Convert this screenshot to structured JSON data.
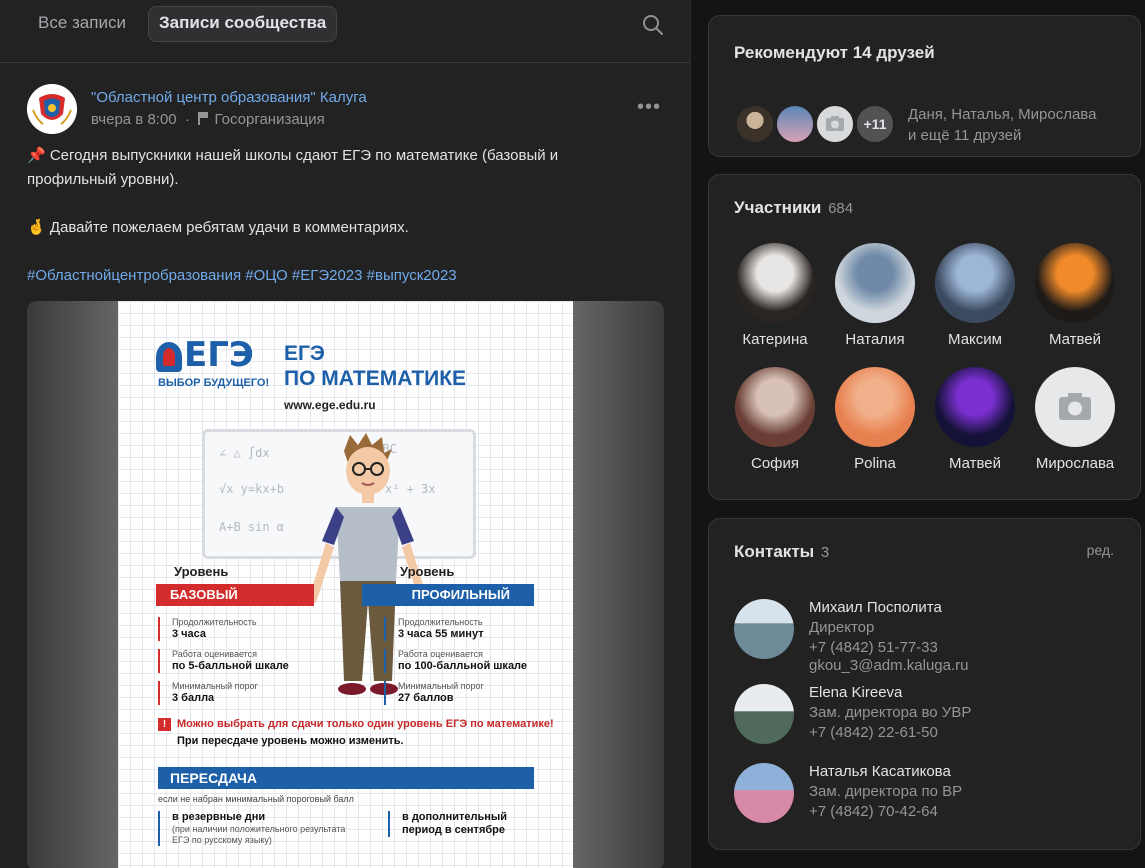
{
  "tabs": {
    "all": "Все записи",
    "community": "Записи сообщества"
  },
  "post": {
    "group_name": "\"Областной центр образования\" Калуга",
    "time": "вчера в 8:00",
    "category": "Госорганизация",
    "line1": "📌 Сегодня выпускники нашей школы сдают ЕГЭ по математике (базовый и профильный уровни).",
    "line2": "🤞 Давайте пожелаем ребятам удачи в комментариях.",
    "hashtags": "#Областнойцентробразования #ОЦО #ЕГЭ2023 #выпуск2023"
  },
  "poster": {
    "logo": "ЕГЭ",
    "logo_sub": "ВЫБОР БУДУЩЕГО!",
    "title1": "ЕГЭ",
    "title2": "ПО МАТЕМАТИКЕ",
    "url": "www.ege.edu.ru",
    "level_word": "Уровень",
    "basic": "БАЗОВЫЙ",
    "profile": "ПРОФИЛЬНЫЙ",
    "b_dur_label": "Продолжительность",
    "b_dur": "3 часа",
    "b_grade_label": "Работа оценивается",
    "b_grade": "по 5-балльной шкале",
    "b_min_label": "Минимальный порог",
    "b_min": "3 балла",
    "p_dur_label": "Продолжительность",
    "p_dur": "3 часа 55 минут",
    "p_grade_label": "Работа оценивается",
    "p_grade": "по 100-балльной шкале",
    "p_min_label": "Минимальный порог",
    "p_min": "27 баллов",
    "warn": "Можно выбрать для сдачи только один уровень ЕГЭ по математике!",
    "warn2": "При пересдаче уровень можно изменить.",
    "resit": "ПЕРЕСДАЧА",
    "resit_note": "если не набран минимальный пороговый балл",
    "reserve": "в резервные дни",
    "reserve_note": "(при наличии положительного результата ЕГЭ по русскому языку)",
    "extra": "в дополнительный период в сентябре"
  },
  "recommend": {
    "title": "Рекомендуют 14 друзей",
    "more": "+11",
    "text1": "Даня, Наталья, Мирослава",
    "text2": "и ещё 11 друзей"
  },
  "members": {
    "title": "Участники",
    "count": "684",
    "list": [
      {
        "name": "Катерина",
        "c1": "#e8e6e4",
        "c2": "#2a2422"
      },
      {
        "name": "Наталия",
        "c1": "#6f8aa8",
        "c2": "#cfd6dd"
      },
      {
        "name": "Максим",
        "c1": "#9cb6d8",
        "c2": "#3b4a5e"
      },
      {
        "name": "Матвей",
        "c1": "#f08a2a",
        "c2": "#1e1a18"
      },
      {
        "name": "София",
        "c1": "#d8c2b8",
        "c2": "#6a3e34"
      },
      {
        "name": "Polina",
        "c1": "#f2b08a",
        "c2": "#e7804f"
      },
      {
        "name": "Матвей",
        "c1": "#7a2fd0",
        "c2": "#141236"
      },
      {
        "name": "Мирослава",
        "c1": "#e7e8ea",
        "c2": "#c9cbce"
      }
    ]
  },
  "contacts": {
    "title": "Контакты",
    "count": "3",
    "edit": "ред.",
    "list": [
      {
        "name": "Михаил Посполита",
        "role": "Директор",
        "phone": "+7 (4842) 51-77-33",
        "email": "gkou_3@adm.kaluga.ru"
      },
      {
        "name": "Elena Kireeva",
        "role": "Зам. директора во УВР",
        "phone": "+7 (4842) 22-61-50"
      },
      {
        "name": "Наталья Касатикова",
        "role": "Зам. директора по ВР",
        "phone": "+7 (4842) 70-42-64"
      }
    ]
  },
  "colors": {
    "accent": "#71aaeb",
    "card": "#222222",
    "bg": "#141414"
  }
}
